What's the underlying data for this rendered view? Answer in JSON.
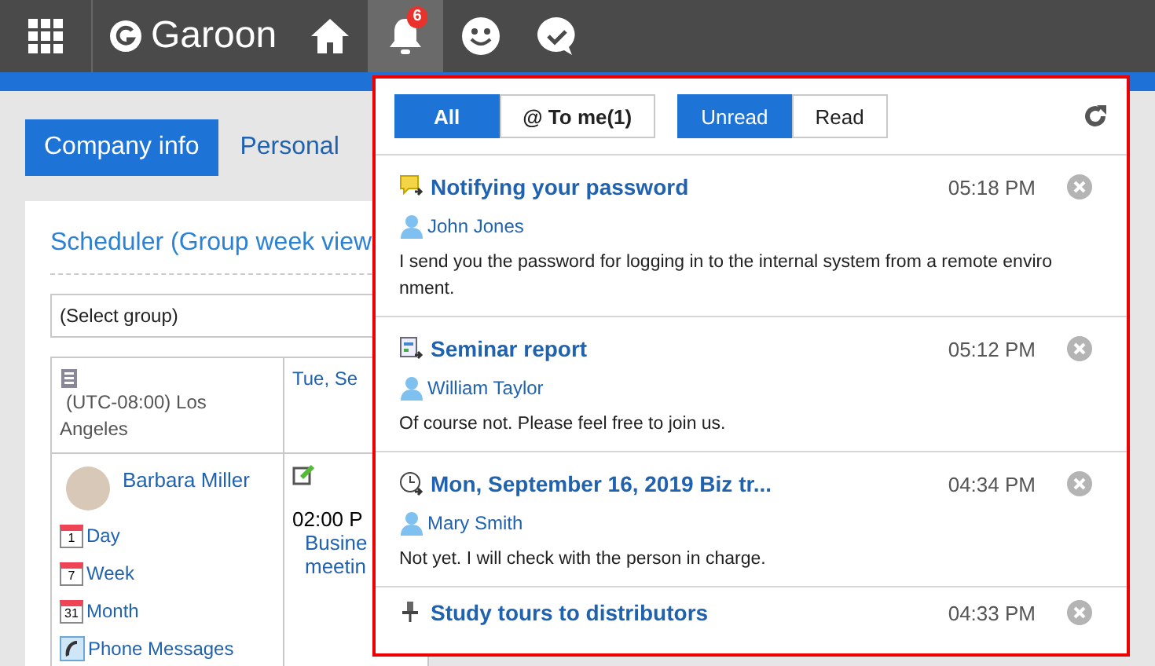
{
  "header": {
    "app_name": "Garoon",
    "notification_count": "6"
  },
  "tabs": [
    {
      "label": "Company info",
      "selected": true
    },
    {
      "label": "Personal",
      "selected": false
    }
  ],
  "portlet": {
    "title": "Scheduler (Group week view",
    "group_select": "(Select group)",
    "timezone": "(UTC-08:00) Los Angeles",
    "date_column": "Tue, Se",
    "user": "Barbara Miller",
    "links": [
      {
        "kind": "calendar",
        "number": "1",
        "label": "Day"
      },
      {
        "kind": "calendar",
        "number": "7",
        "label": "Week"
      },
      {
        "kind": "calendar",
        "number": "31",
        "label": "Month"
      },
      {
        "kind": "phone",
        "label": "Phone Messages"
      }
    ],
    "event_time": "02:00 P",
    "event_title": [
      "Busine",
      "meetin"
    ]
  },
  "notifications_popup": {
    "filters": [
      {
        "label": "All",
        "selected": true
      },
      {
        "label": "@ To me(1)",
        "selected": false
      }
    ],
    "read_filters": [
      {
        "label": "Unread",
        "selected": true
      },
      {
        "label": "Read",
        "selected": false
      }
    ],
    "items": [
      {
        "kind": "message",
        "title": "Notifying your password",
        "time": "05:18 PM",
        "sender": "John Jones",
        "body": "I send you the password for logging in to the internal system from a remote environment."
      },
      {
        "kind": "report",
        "title": "Seminar report",
        "time": "05:12 PM",
        "sender": "William Taylor",
        "body": "Of course not. Please feel free to join us."
      },
      {
        "kind": "schedule",
        "title": "Mon, September 16, 2019 Biz tr...",
        "time": "04:34 PM",
        "sender": "Mary Smith",
        "body": "Not yet. I will check with the person in charge."
      },
      {
        "kind": "workflow",
        "title": "Study tours to distributors",
        "time": "04:33 PM"
      }
    ]
  }
}
